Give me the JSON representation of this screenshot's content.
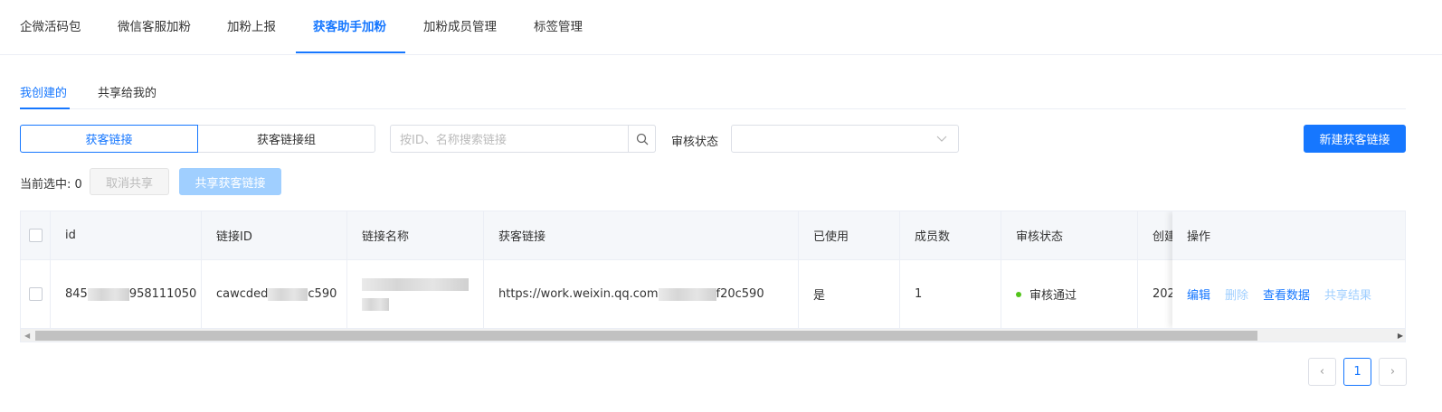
{
  "top_tabs": [
    "企微活码包",
    "微信客服加粉",
    "加粉上报",
    "获客助手加粉",
    "加粉成员管理",
    "标签管理"
  ],
  "sub_tabs": [
    "我创建的",
    "共享给我的"
  ],
  "segment": [
    "获客链接",
    "获客链接组"
  ],
  "search": {
    "placeholder": "按ID、名称搜索链接"
  },
  "status_filter": {
    "label": "审核状态",
    "value": ""
  },
  "new_button": "新建获客链接",
  "selection": {
    "label": "当前选中: 0",
    "cancel_share": "取消共享",
    "share": "共享获客链接"
  },
  "table": {
    "headers": [
      "id",
      "链接ID",
      "链接名称",
      "获客链接",
      "已使用",
      "成员数",
      "审核状态",
      "创建",
      "操作"
    ],
    "rows": [
      {
        "id_prefix": "845",
        "id_suffix": "958111050",
        "link_id_prefix": "cawcded",
        "link_id_suffix": "c590",
        "url_prefix": "https://work.weixin.qq.com",
        "url_suffix": "f20c590",
        "used": "是",
        "members": "1",
        "status": "审核通过",
        "created": "202",
        "actions": [
          "编辑",
          "删除",
          "查看数据",
          "共享结果"
        ]
      }
    ]
  },
  "pagination": {
    "current": "1"
  },
  "colors": {
    "primary": "#1677ff",
    "success": "#52c41a"
  }
}
